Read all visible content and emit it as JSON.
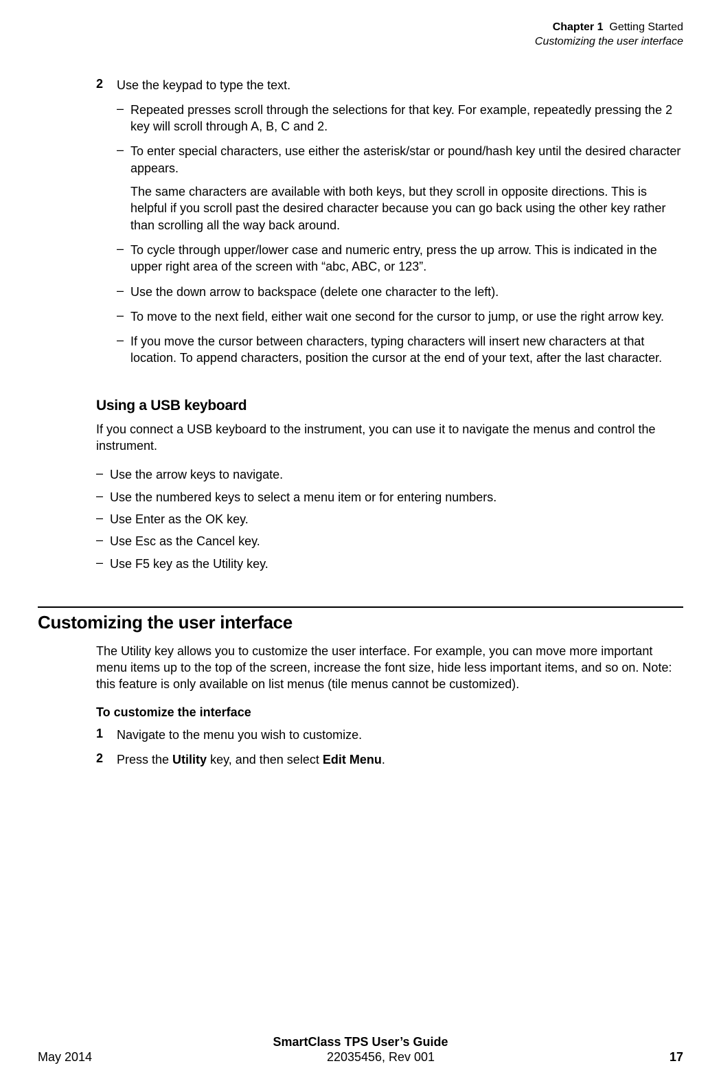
{
  "header": {
    "chapter_label": "Chapter 1",
    "chapter_title": "Getting Started",
    "section_title": "Customizing the user interface"
  },
  "step2": {
    "num": "2",
    "text": "Use the keypad to type the text.",
    "bullets": [
      {
        "text": "Repeated presses scroll through the selections for that key. For example, repeatedly pressing the 2 key will scroll through A, B, C and 2."
      },
      {
        "text": "To enter special characters, use either the asterisk/star or pound/hash key until the desired character appears.",
        "continue": "The same characters are available with both keys, but they scroll in opposite directions. This is helpful if you scroll past the desired character because you can go back using the other key rather than scrolling all the way back around."
      },
      {
        "text": "To cycle through upper/lower case and numeric entry, press the up arrow. This is indicated in the upper right area of the screen with “abc, ABC, or 123”."
      },
      {
        "text": "Use the down arrow to backspace (delete one character to the left)."
      },
      {
        "text": "To move to the next field, either wait one second for the cursor to jump, or use the right arrow key."
      },
      {
        "text": "If you move the cursor between characters, typing characters will insert new characters at that location. To append characters, position the cursor at the end of your text, after the last character."
      }
    ]
  },
  "usb": {
    "heading": "Using a USB keyboard",
    "intro": "If you connect a USB keyboard to the instrument, you can use it to navigate the menus and control the instrument.",
    "bullets": [
      "Use the arrow keys to navigate.",
      "Use the numbered keys to select a menu item or for entering numbers.",
      "Use Enter as the OK key.",
      "Use Esc as the Cancel key.",
      "Use F5 key as the Utility key."
    ]
  },
  "customize": {
    "heading": "Customizing the user interface",
    "intro": "The Utility key allows you to customize the user interface. For example, you can move more important menu items up to the top of the screen, increase the font size, hide less important items, and so on. Note: this feature is only available on list menus (tile menus cannot be customized).",
    "subheading": "To customize the interface",
    "step1": {
      "num": "1",
      "text": "Navigate to the menu you wish to customize."
    },
    "step2": {
      "num": "2",
      "prefix": "Press the ",
      "bold1": "Utility",
      "mid": " key, and then select ",
      "bold2": "Edit Menu",
      "suffix": "."
    }
  },
  "footer": {
    "guide": "SmartClass TPS User’s Guide",
    "docnum": "22035456, Rev 001",
    "date": "May 2014",
    "page": "17"
  }
}
